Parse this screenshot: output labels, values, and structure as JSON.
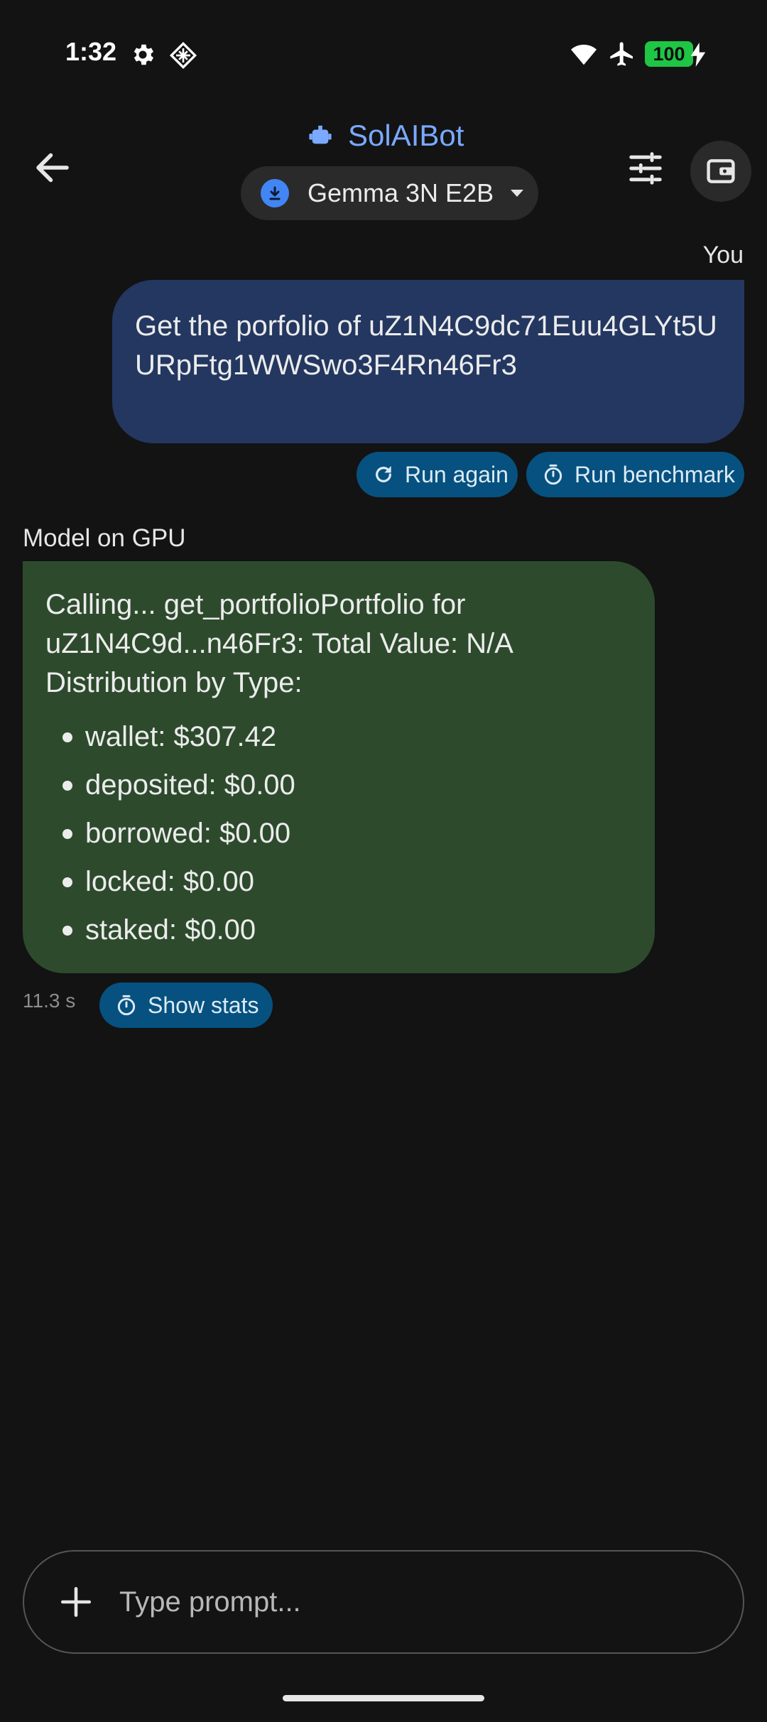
{
  "status_bar": {
    "time": "1:32",
    "battery": "100",
    "icons": [
      "gear-icon",
      "diamond-icon",
      "wifi-icon",
      "airplane-icon",
      "battery-icon",
      "bolt-icon"
    ]
  },
  "header": {
    "title": "SolAIBot",
    "model_name": "Gemma 3N E2B",
    "accent_color": "#7aa9ff"
  },
  "conversation": {
    "user": {
      "label": "You",
      "message": "Get the porfolio of uZ1N4C9dc71Euu4GLYt5UURpFtg1WWSwo3F4Rn46Fr3",
      "actions": [
        "Run again",
        "Run benchmark"
      ]
    },
    "model": {
      "label": "Model on GPU",
      "message_intro": "Calling... get_portfolioPortfolio for uZ1N4C9d...n46Fr3: Total Value: N/A Distribution by Type:",
      "distribution": [
        "wallet: $307.42",
        "deposited: $0.00",
        "borrowed: $0.00",
        "locked: $0.00",
        "staked: $0.00"
      ],
      "elapsed": "11.3 s",
      "stats_label": "Show stats"
    }
  },
  "input": {
    "placeholder": "Type prompt..."
  },
  "colors": {
    "background": "#131313",
    "user_bubble": "#233760",
    "model_bubble": "#2d4a2d",
    "chip": "#06517f",
    "battery": "#1fc545"
  }
}
